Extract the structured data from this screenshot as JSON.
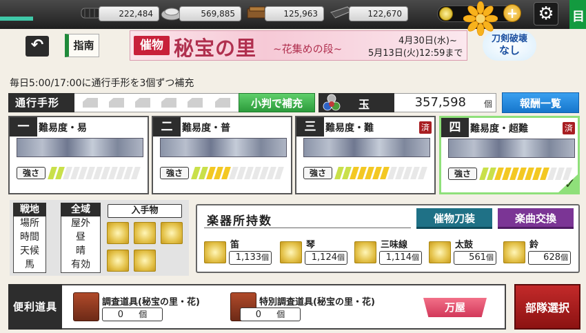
{
  "resources": [
    {
      "name": "charcoal",
      "value": "222,484",
      "icon": "charcoal-icon"
    },
    {
      "name": "steel",
      "value": "569,885",
      "icon": "steel-icon"
    },
    {
      "name": "cooling-material",
      "value": "125,963",
      "icon": "cooling-icon"
    },
    {
      "name": "whetstone",
      "value": "122,670",
      "icon": "whetstone-icon"
    }
  ],
  "header": {
    "guide_label": "指南",
    "banner_badge": "催物",
    "banner_title": "秘宝の里",
    "banner_subtitle": "~花集めの段~",
    "banner_date_start": "4月30日(水)~",
    "banner_date_end": "5月13日(火)12:59まで",
    "no_break_badge": "刀剣破壊\nなし",
    "right_tab": "目"
  },
  "notice": "毎日5:00/17:00に通行手形を3個ずつ補充",
  "pass": {
    "label": "通行手形",
    "refill_button": "小判で補充"
  },
  "orb": {
    "label": "玉",
    "value": "357,598",
    "unit": "個"
  },
  "reward_button": "報酬一覧",
  "difficulties": [
    {
      "num": "一",
      "title": "難易度・易",
      "done": false,
      "strength_fill": 0.2
    },
    {
      "num": "二",
      "title": "難易度・普",
      "done": false,
      "strength_fill": 0.4
    },
    {
      "num": "三",
      "title": "難易度・難",
      "done": true,
      "done_label": "済",
      "strength_fill": 0.6
    },
    {
      "num": "四",
      "title": "難易度・超難",
      "done": true,
      "done_label": "済",
      "strength_fill": 0.75,
      "selected": true
    }
  ],
  "strength_label": "強さ",
  "environment": {
    "keys": [
      "戦地",
      "場所",
      "時間",
      "天候",
      "馬"
    ],
    "values": [
      "全域",
      "屋外",
      "昼",
      "晴",
      "有効"
    ],
    "acquire_label": "入手物"
  },
  "instruments": {
    "title": "楽器所持数",
    "sword_button": "催物刀装",
    "song_button": "楽曲交換",
    "items": [
      {
        "name": "笛",
        "count": "1,133",
        "unit": "個"
      },
      {
        "name": "琴",
        "count": "1,124",
        "unit": "個"
      },
      {
        "name": "三味線",
        "count": "1,114",
        "unit": "個"
      },
      {
        "name": "太鼓",
        "count": "561",
        "unit": "個"
      },
      {
        "name": "鈴",
        "count": "628",
        "unit": "個"
      }
    ]
  },
  "tools": {
    "label": "便利道具",
    "items": [
      {
        "name": "調査道具(秘宝の里・花)",
        "count": "0",
        "unit": "個"
      },
      {
        "name": "特別調査道具(秘宝の里・花)",
        "count": "0",
        "unit": "個"
      }
    ],
    "shop_button": "万屋"
  },
  "deploy_button": "部隊選択",
  "colors": {
    "accent_green": "#2c9b3b",
    "banner_pink": "#b0304f",
    "reward_blue": "#1676cc",
    "deploy_red": "#a81e22"
  }
}
